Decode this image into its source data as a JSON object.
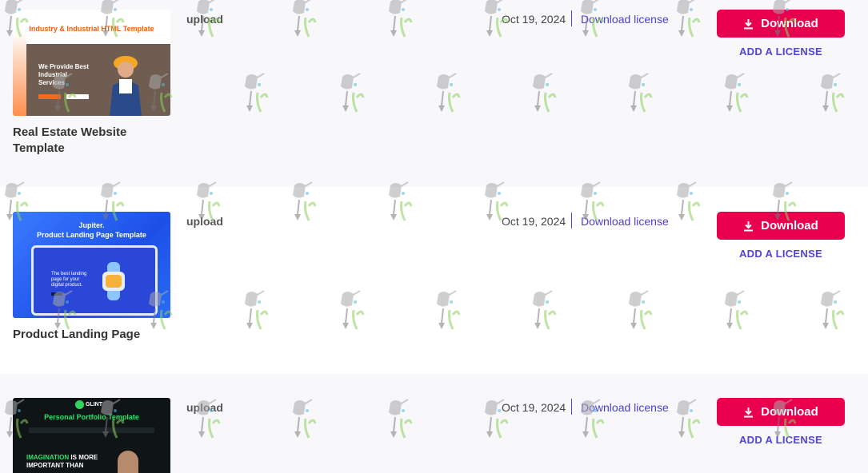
{
  "rows": [
    {
      "type_label": "upload",
      "date": "Oct 19, 2024",
      "license_link": "Download license",
      "download_label": "Download",
      "add_license_label": "ADD A LICENSE",
      "title": "Real Estate Website Template",
      "thumb": {
        "title": "Industry & Industrial HTML Template",
        "hero_text": "We Provide Best Industrial Services"
      }
    },
    {
      "type_label": "upload",
      "date": "Oct 19, 2024",
      "license_link": "Download license",
      "download_label": "Download",
      "add_license_label": "ADD A LICENSE",
      "title": "Product Landing Page",
      "thumb": {
        "title_line1": "Jupiter.",
        "title_line2": "Product  Landing Page Template",
        "screen_text": "The best landing page for your digital product."
      }
    },
    {
      "type_label": "upload",
      "date": "Oct 19, 2024",
      "license_link": "Download license",
      "download_label": "Download",
      "add_license_label": "ADD A LICENSE",
      "thumb": {
        "logo": "GLINT",
        "title": "Personal Portfolio Template",
        "headline_a": "IMAGINATION",
        "headline_b": " IS MORE",
        "headline_c": "IMPORTANT THAN"
      }
    }
  ],
  "colors": {
    "download_button": "#e8004f",
    "link": "#4b3fd0",
    "row_alt_bg": "#f8f8fb"
  },
  "icons": {
    "download": "download-icon"
  }
}
